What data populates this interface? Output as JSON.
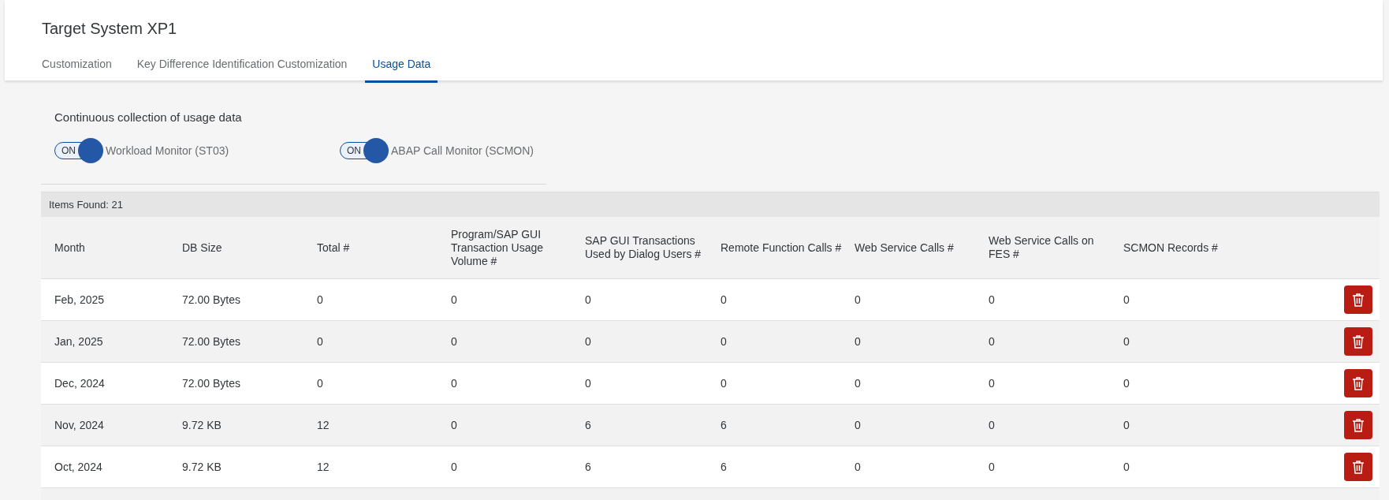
{
  "header": {
    "title": "Target System XP1"
  },
  "tabs": [
    {
      "label": "Customization",
      "selected": false
    },
    {
      "label": "Key Difference Identification Customization",
      "selected": false
    },
    {
      "label": "Usage Data",
      "selected": true
    }
  ],
  "collection": {
    "heading": "Continuous collection of usage data",
    "switches": [
      {
        "label": "Workload Monitor (ST03)",
        "state_text": "ON",
        "on": true
      },
      {
        "label": "ABAP Call Monitor (SCMON)",
        "state_text": "ON",
        "on": true
      }
    ]
  },
  "table": {
    "items_found": "Items Found: 21",
    "columns": [
      "Month",
      "DB Size",
      "Total #",
      "Program/SAP GUI Transaction Usage Volume #",
      "SAP GUI Transactions Used by Dialog Users #",
      "Remote Function Calls #",
      "Web Service Calls #",
      "Web Service Calls on FES #",
      "SCMON Records #"
    ],
    "rows": [
      {
        "cells": [
          "Feb, 2025",
          "72.00 Bytes",
          "0",
          "0",
          "0",
          "0",
          "0",
          "0",
          "0"
        ]
      },
      {
        "cells": [
          "Jan, 2025",
          "72.00 Bytes",
          "0",
          "0",
          "0",
          "0",
          "0",
          "0",
          "0"
        ]
      },
      {
        "cells": [
          "Dec, 2024",
          "72.00 Bytes",
          "0",
          "0",
          "0",
          "0",
          "0",
          "0",
          "0"
        ]
      },
      {
        "cells": [
          "Nov, 2024",
          "9.72 KB",
          "12",
          "0",
          "6",
          "6",
          "0",
          "0",
          "0"
        ]
      },
      {
        "cells": [
          "Oct, 2024",
          "9.72 KB",
          "12",
          "0",
          "6",
          "6",
          "0",
          "0",
          "0"
        ]
      }
    ]
  }
}
